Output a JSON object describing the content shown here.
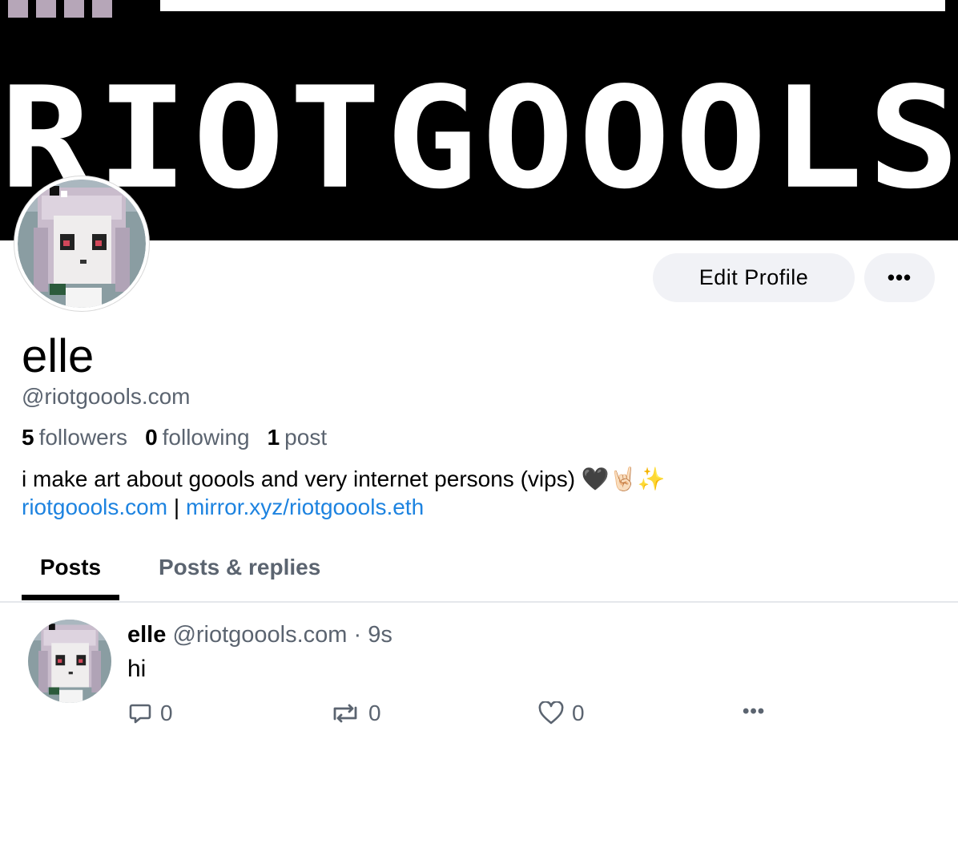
{
  "banner": {
    "text": "RIOTGOOOLS"
  },
  "profile": {
    "display_name": "elle",
    "handle": "@riotgoools.com",
    "followers_count": "5",
    "followers_label": "followers",
    "following_count": "0",
    "following_label": "following",
    "posts_count": "1",
    "posts_label": "post",
    "bio": "i make art about goools and very internet persons (vips) 🖤🤘🏻✨",
    "link1": "riotgoools.com",
    "separator": "|",
    "link2": "mirror.xyz/riotgoools.eth"
  },
  "buttons": {
    "edit_profile": "Edit Profile",
    "more": "•••"
  },
  "tabs": [
    {
      "label": "Posts",
      "active": true
    },
    {
      "label": "Posts & replies",
      "active": false
    }
  ],
  "post": {
    "author": "elle",
    "handle": "@riotgoools.com",
    "separator": "·",
    "time": "9s",
    "text": "hi",
    "reply_count": "0",
    "repost_count": "0",
    "like_count": "0",
    "more": "•••"
  },
  "icons": [
    "comment-icon",
    "repost-icon",
    "heart-icon",
    "more-icon"
  ],
  "colors": {
    "link": "#1d83e0",
    "muted": "#5b6470",
    "button_bg": "#f1f2f6"
  }
}
